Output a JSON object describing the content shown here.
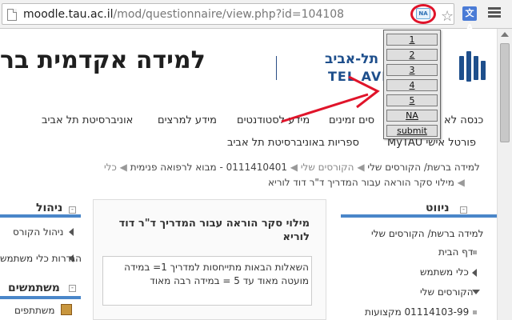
{
  "browser": {
    "url_host": "moodle.tau.ac.il",
    "url_path": "/mod/questionnaire/view.php?id=104108",
    "extension_label": "NA",
    "translate_label": "文A",
    "star_glyph": "☆",
    "page_icon": "page-icon",
    "menu_icon": "hamburger-icon"
  },
  "header": {
    "site_title": "למידה אקדמית בר",
    "logo_he": "אוני תל-אביב",
    "logo_en": "TEL AVIV U TY"
  },
  "nav": {
    "row1": [
      "אוניברסיטת תל אביב",
      "מידע למרצים",
      "מידע לסטודנטים",
      "סים זמינים",
      "כנסה לא"
    ],
    "row2": [
      "ספריות באוניברסיטת תל אביב",
      "פורטל אישי MyTAU"
    ]
  },
  "breadcrumb": {
    "items": [
      "למידה ברשת/ הקורסים שלי",
      "הקורסים שלי",
      "0111410401 - מבוא לרפואה פנימית",
      "כלי"
    ],
    "line2": "מילוי סקר הוראה עבור המדריך ד\"ר דוד לוריא"
  },
  "nav_block": {
    "title": "ניווט",
    "collapse": "-",
    "items": [
      "למידה ברשת/ הקורסים שלי",
      "דף הבית",
      "כלי משתמש",
      "הקורסים שלי",
      "01114103-99 מקצועות"
    ]
  },
  "admin_block": {
    "title": "ניהול",
    "collapse": "-",
    "items": [
      "ניהול הקורס",
      "הגדרות כלי משתמש"
    ]
  },
  "users_block": {
    "title": "משתמשים",
    "collapse": "-",
    "items": [
      "משתתפים"
    ]
  },
  "main": {
    "title": "מילוי סקר הוראה עבור המדריך ד\"ר דוד לוריא",
    "intro": "השאלות הבאות מתייחסות למדריך 1= במידה מועטה מאוד עד 5 = במידה רבה מאוד"
  },
  "popup": {
    "buttons": [
      "1",
      "2",
      "3",
      "4",
      "5",
      "NA",
      "submit"
    ]
  },
  "colors": {
    "accent": "#4a86c9",
    "annotation": "#e0142a",
    "logo": "#1e4f8c"
  }
}
